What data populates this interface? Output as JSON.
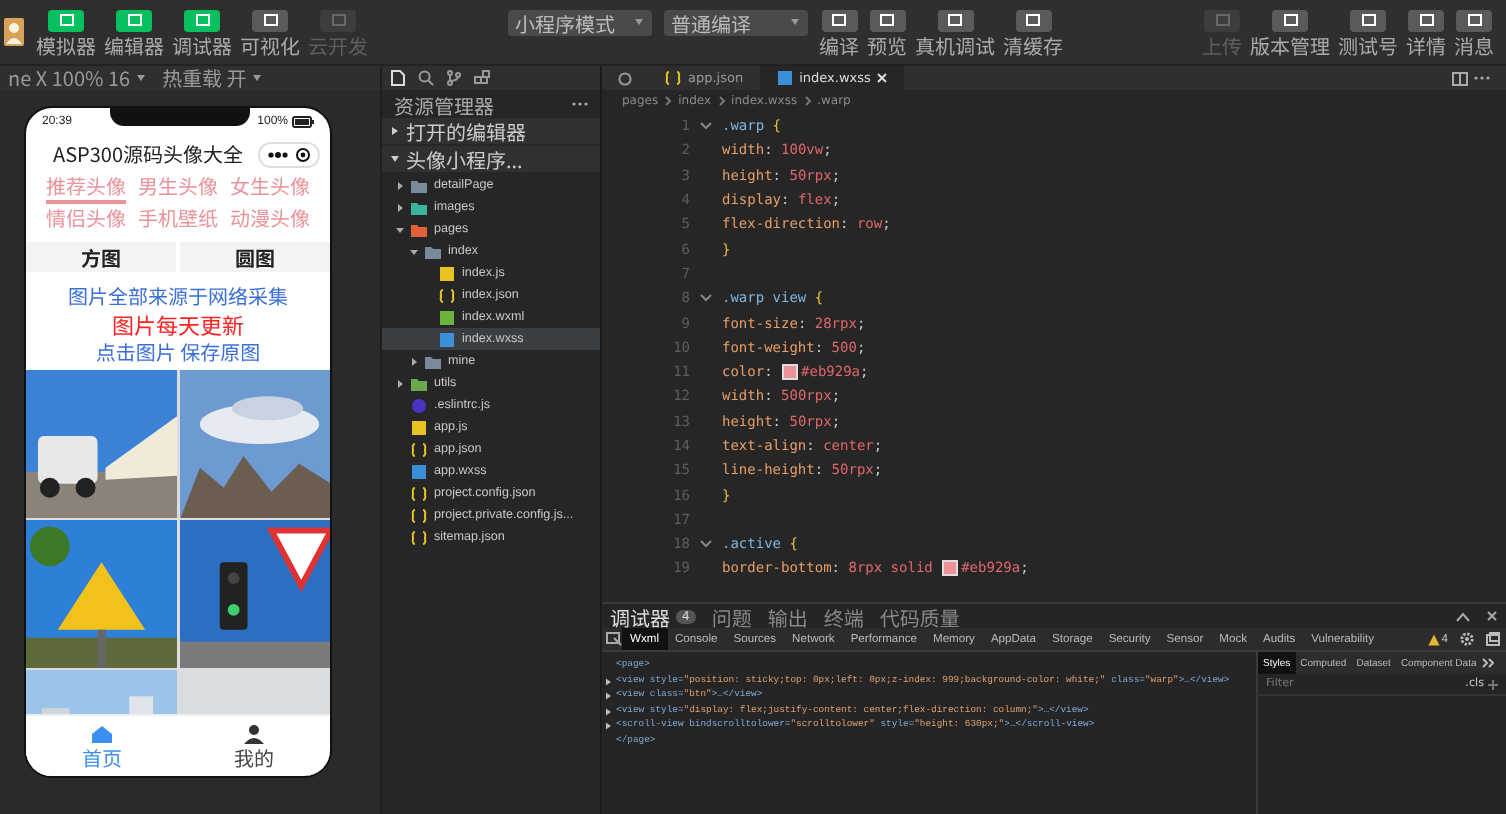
{
  "toolbar": {
    "left_buttons": [
      {
        "label": "模拟器",
        "on": true,
        "disabled": false
      },
      {
        "label": "编辑器",
        "on": true,
        "disabled": false
      },
      {
        "label": "调试器",
        "on": true,
        "disabled": false
      },
      {
        "label": "可视化",
        "on": false,
        "disabled": false
      },
      {
        "label": "云开发",
        "on": false,
        "disabled": true
      }
    ],
    "mode_select": "小程序模式",
    "compile_select": "普通编译",
    "actions": [
      {
        "label": "编译",
        "disabled": false
      },
      {
        "label": "预览",
        "disabled": false
      },
      {
        "label": "真机调试",
        "disabled": false
      },
      {
        "label": "清缓存",
        "disabled": false
      }
    ],
    "right_actions": [
      {
        "label": "上传",
        "disabled": true
      },
      {
        "label": "版本管理",
        "disabled": false
      },
      {
        "label": "测试号",
        "disabled": false
      },
      {
        "label": "详情",
        "disabled": false
      },
      {
        "label": "消息",
        "disabled": false
      }
    ]
  },
  "simulator": {
    "device": "ne X 100% 16",
    "hot_reload": "热重载 开",
    "phone": {
      "time": "20:39",
      "battery": "100%",
      "title": "ASP300源码头像大全",
      "tabs": [
        {
          "label": "推荐头像",
          "selected": true
        },
        {
          "label": "男生头像",
          "selected": false
        },
        {
          "label": "女生头像",
          "selected": false
        },
        {
          "label": "情侣头像",
          "selected": false
        },
        {
          "label": "手机壁纸",
          "selected": false
        },
        {
          "label": "动漫头像",
          "selected": false
        }
      ],
      "shape_buttons": [
        "方图",
        "圆图"
      ],
      "notice": "图片全部来源于网络采集",
      "notice_highlight": "图片每天更新",
      "hint": "点击图片 保存原图",
      "tabbar": [
        {
          "label": "首页",
          "selected": true
        },
        {
          "label": "我的",
          "selected": false
        }
      ]
    }
  },
  "explorer": {
    "title": "资源管理器",
    "sections": [
      {
        "label": "打开的编辑器",
        "expanded": false
      },
      {
        "label": "头像小程序...",
        "expanded": true
      }
    ],
    "tree": [
      {
        "label": "detailPage",
        "kind": "folder",
        "expanded": false,
        "selected": false
      },
      {
        "label": "images",
        "kind": "folder",
        "expanded": false,
        "selected": false
      },
      {
        "label": "pages",
        "kind": "folder",
        "expanded": true,
        "selected": false,
        "children": [
          {
            "label": "index",
            "kind": "folder",
            "expanded": true,
            "selected": false,
            "children": [
              {
                "label": "index.js",
                "kind": "js",
                "selected": false
              },
              {
                "label": "index.json",
                "kind": "json",
                "selected": false
              },
              {
                "label": "index.wxml",
                "kind": "wxml",
                "selected": false
              },
              {
                "label": "index.wxss",
                "kind": "wxss",
                "selected": true
              }
            ]
          },
          {
            "label": "mine",
            "kind": "folder",
            "expanded": false,
            "selected": false
          }
        ]
      },
      {
        "label": "utils",
        "kind": "folder",
        "expanded": false,
        "selected": false
      },
      {
        "label": ".eslintrc.js",
        "kind": "eslint",
        "selected": false
      },
      {
        "label": "app.js",
        "kind": "js",
        "selected": false
      },
      {
        "label": "app.json",
        "kind": "json",
        "selected": false
      },
      {
        "label": "app.wxss",
        "kind": "wxss",
        "selected": false
      },
      {
        "label": "project.config.json",
        "kind": "json",
        "selected": false
      },
      {
        "label": "project.private.config.js...",
        "kind": "json",
        "selected": false
      },
      {
        "label": "sitemap.json",
        "kind": "json",
        "selected": false
      }
    ]
  },
  "editor": {
    "tabs": [
      {
        "label": "app.json",
        "kind": "json",
        "selected": false
      },
      {
        "label": "index.wxss",
        "kind": "wxss",
        "selected": true
      }
    ],
    "breadcrumb": [
      "pages",
      "index",
      "index.wxss",
      ".warp"
    ],
    "lines": [
      {
        "number": "1",
        "text": ".warp {",
        "foldable": true
      },
      {
        "number": "2",
        "text": "  width: 100vw;",
        "foldable": false
      },
      {
        "number": "3",
        "text": "  height: 50rpx;",
        "foldable": false
      },
      {
        "number": "4",
        "text": "  display: flex;",
        "foldable": false
      },
      {
        "number": "5",
        "text": "  flex-direction: row;",
        "foldable": false
      },
      {
        "number": "6",
        "text": "}",
        "foldable": false
      },
      {
        "number": "7",
        "foldable": false
      },
      {
        "number": "8",
        "text": ".warp view {",
        "foldable": true
      },
      {
        "number": "9",
        "text": "  font-size: 28rpx;",
        "foldable": false
      },
      {
        "number": "10",
        "text": "  font-weight: 500;",
        "foldable": false
      },
      {
        "number": "11",
        "text": "  color: #eb929a;",
        "foldable": false,
        "color": "#eb929a"
      },
      {
        "number": "12",
        "text": "  width: 500rpx;",
        "foldable": false
      },
      {
        "number": "13",
        "text": "  height: 50rpx;",
        "foldable": false
      },
      {
        "number": "14",
        "text": "  text-align: center;",
        "foldable": false
      },
      {
        "number": "15",
        "text": "  line-height: 50rpx;",
        "foldable": false
      },
      {
        "number": "16",
        "text": "}",
        "foldable": false
      },
      {
        "number": "17",
        "foldable": false
      },
      {
        "number": "18",
        "text": ".active {",
        "foldable": true
      },
      {
        "number": "19",
        "text": "  border-bottom: 8rpx solid #eb929a;",
        "foldable": false,
        "color": "#eb929a"
      }
    ]
  },
  "debugger": {
    "tabs": [
      {
        "label": "调试器",
        "badge": "4",
        "selected": true
      },
      {
        "label": "问题",
        "selected": false
      },
      {
        "label": "输出",
        "selected": false
      },
      {
        "label": "终端",
        "selected": false
      },
      {
        "label": "代码质量",
        "selected": false
      }
    ],
    "devtools_tabs": [
      {
        "label": "Wxml",
        "selected": true
      },
      {
        "label": "Console",
        "selected": false
      },
      {
        "label": "Sources",
        "selected": false
      },
      {
        "label": "Network",
        "selected": false
      },
      {
        "label": "Performance",
        "selected": false
      },
      {
        "label": "Memory",
        "selected": false
      },
      {
        "label": "AppData",
        "selected": false
      },
      {
        "label": "Storage",
        "selected": false
      },
      {
        "label": "Security",
        "selected": false
      },
      {
        "label": "Sensor",
        "selected": false
      },
      {
        "label": "Mock",
        "selected": false
      },
      {
        "label": "Audits",
        "selected": false
      },
      {
        "label": "Vulnerability",
        "selected": false
      }
    ],
    "warnings": "4",
    "wxml": [
      {
        "text": "<page>",
        "expandable": false
      },
      {
        "text": "<view style=\"position: sticky;top: 0px;left: 0px;z-index: 999;background-color: white;\" class=\"warp\">…</view>",
        "expandable": true
      },
      {
        "text": "<view class=\"btn\">…</view>",
        "expandable": true
      },
      {
        "text": "<view style=\"display: flex;justify-content: center;flex-direction: column;\">…</view>",
        "expandable": true
      },
      {
        "text": "<scroll-view bindscrolltolower=\"scrolltolower\" style=\"height: 630px;\">…</scroll-view>",
        "expandable": true
      },
      {
        "text": "</page>",
        "expandable": false
      }
    ],
    "side_tabs": [
      {
        "label": "Styles",
        "selected": true
      },
      {
        "label": "Computed",
        "selected": false
      },
      {
        "label": "Dataset",
        "selected": false
      },
      {
        "label": "Component Data",
        "selected": false
      }
    ],
    "filter_placeholder": "Filter",
    "cls": ".cls"
  }
}
